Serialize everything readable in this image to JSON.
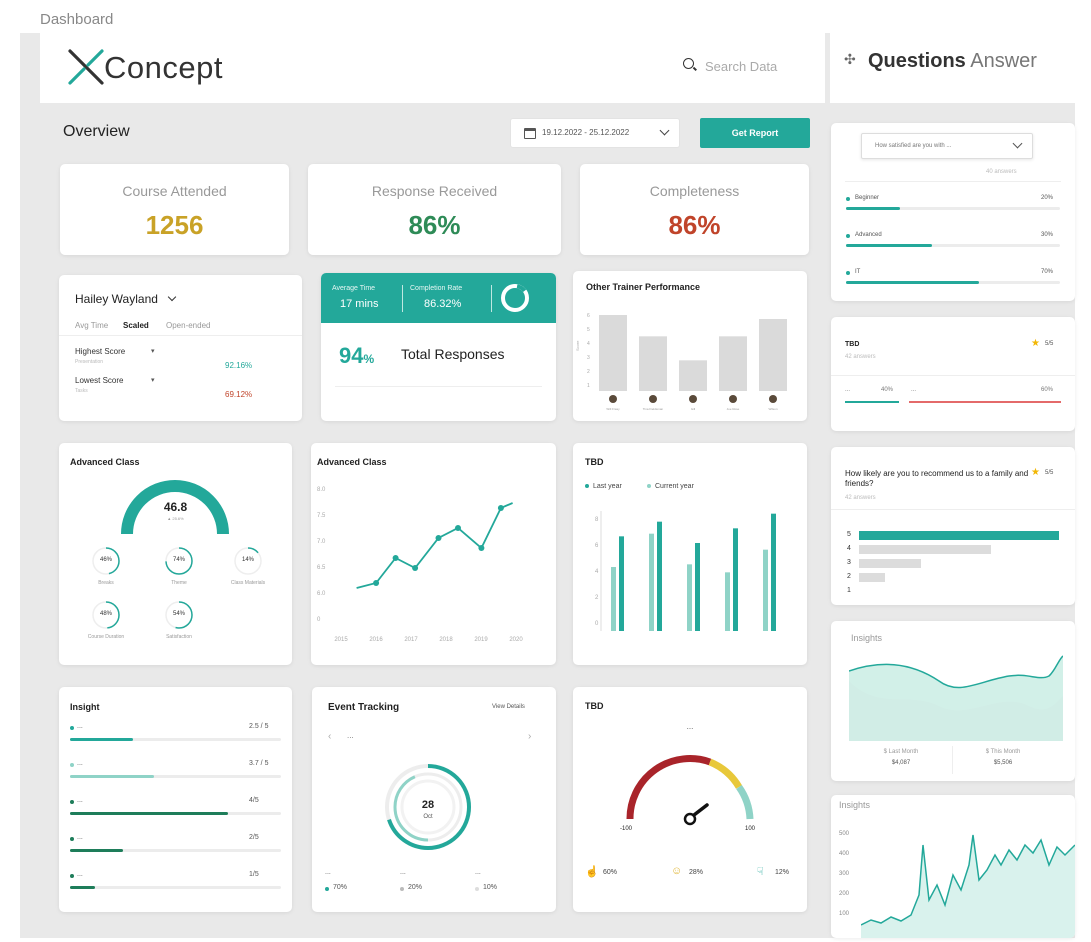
{
  "frame_label": "Dashboard",
  "header": {
    "logo_text": "Concept",
    "search_placeholder": "Search Data"
  },
  "overview": {
    "title": "Overview",
    "date_range": "19.12.2022 - 25.12.2022",
    "report_button": "Get Report"
  },
  "stats": [
    {
      "label": "Course Attended",
      "value": "1256",
      "color": "#c9a227"
    },
    {
      "label": "Response Received",
      "value": "86%",
      "color": "#2e8b57"
    },
    {
      "label": "Completeness",
      "value": "86%",
      "color": "#c0442a"
    }
  ],
  "trainer": {
    "name": "Hailey Wayland",
    "tabs": [
      "Avg Time",
      "Scaled",
      "Open-ended"
    ],
    "active_tab": "Scaled",
    "rows": [
      {
        "label": "Highest Score",
        "sub": "Presentation",
        "value": "92.16%",
        "color": "#23a89a"
      },
      {
        "label": "Lowest Score",
        "sub": "Tasks",
        "value": "69.12%",
        "color": "#c0442a"
      }
    ]
  },
  "responses": {
    "avg_time_label": "Average Time",
    "avg_time_value": "17 mins",
    "completion_label": "Completion Rate",
    "completion_value": "86.32%",
    "percent": "94",
    "percent_sign": "%",
    "total_label": "Total Responses"
  },
  "trainer_perf": {
    "title": "Other Trainer Performance",
    "ylabel": "Score",
    "yticks": [
      "6",
      "5",
      "4",
      "3",
      "2",
      "1"
    ],
    "names": [
      "Will Frasy",
      "Tina Fieldsman",
      "Gill",
      "Joe Rose",
      "Wilson"
    ],
    "chart_data": {
      "type": "bar",
      "categories": [
        "Will Frasy",
        "Tina Fieldsman",
        "Gill",
        "Joe Rose",
        "Wilson"
      ],
      "values": [
        5.7,
        4.1,
        2.3,
        4.1,
        5.4
      ],
      "ylim": [
        0,
        6
      ]
    }
  },
  "advanced_gauge": {
    "title": "Advanced Class",
    "value": "46.8",
    "delta": "▲ 25.6%",
    "rings": [
      {
        "pct": "46%",
        "label": "Breaks",
        "value": 46
      },
      {
        "pct": "74%",
        "label": "Theme",
        "value": 74
      },
      {
        "pct": "14%",
        "label": "Class Materials",
        "value": 14
      },
      {
        "pct": "48%",
        "label": "Course Duration",
        "value": 48
      },
      {
        "pct": "54%",
        "label": "Satisfaction",
        "value": 54
      }
    ]
  },
  "advanced_line": {
    "title": "Advanced Class",
    "chart_data": {
      "type": "line",
      "x": [
        "2015",
        "2016",
        "2017",
        "2018",
        "2019",
        "2020"
      ],
      "yticks": [
        "8.0",
        "7.5",
        "7.0",
        "6.5",
        "6.0",
        "0"
      ],
      "points": [
        [
          2015.4,
          6.0
        ],
        [
          2015.9,
          6.1
        ],
        [
          2016.4,
          6.6
        ],
        [
          2016.9,
          6.4
        ],
        [
          2017.5,
          7.0
        ],
        [
          2018.0,
          7.2
        ],
        [
          2018.6,
          6.8
        ],
        [
          2019.1,
          7.6
        ],
        [
          2019.4,
          7.7
        ]
      ],
      "ylim": [
        5.4,
        8.0
      ]
    }
  },
  "tbd_bars": {
    "title": "TBD",
    "legend": [
      "Last year",
      "Current year"
    ],
    "colors": [
      "#8fd3c7",
      "#23a89a"
    ],
    "yticks": [
      "8",
      "6",
      "4",
      "2",
      "0"
    ],
    "chart_data": {
      "type": "bar",
      "series": [
        {
          "name": "Last year",
          "values": [
            4.8,
            7.3,
            5.0,
            4.4,
            6.1
          ]
        },
        {
          "name": "Current year",
          "values": [
            7.1,
            8.2,
            6.6,
            7.7,
            8.8
          ]
        }
      ],
      "ylim": [
        0,
        9
      ]
    }
  },
  "insight": {
    "title": "Insight",
    "rows": [
      {
        "label": "...",
        "value": "2.5 / 5",
        "fill": 0.3,
        "color": "#23a89a"
      },
      {
        "label": "...",
        "value": "3.7 / 5",
        "fill": 0.4,
        "color": "#8fd3c7"
      },
      {
        "label": "...",
        "value": "4/5",
        "fill": 0.75,
        "color": "#1e7d5a"
      },
      {
        "label": "...",
        "value": "2/5",
        "fill": 0.25,
        "color": "#1e7d5a"
      },
      {
        "label": "...",
        "value": "1/5",
        "fill": 0.12,
        "color": "#1e7d5a"
      }
    ]
  },
  "event": {
    "title": "Event Tracking",
    "details": "View Details",
    "nav_text": "...",
    "day": "28",
    "month": "Oct",
    "legend": [
      {
        "label": "...",
        "pct": "70%",
        "color": "#23a89a"
      },
      {
        "label": "...",
        "pct": "20%",
        "color": "#bbbbbb"
      },
      {
        "label": "...",
        "pct": "10%",
        "color": "#dddddd"
      }
    ]
  },
  "tbd_gauge": {
    "title": "TBD",
    "top_text": "...",
    "min": "-100",
    "max": "100",
    "stats": [
      {
        "icon": "thumbs-up-icon",
        "pct": "60%",
        "color": "#c0442a"
      },
      {
        "icon": "neutral-icon",
        "pct": "28%",
        "color": "#e0b532"
      },
      {
        "icon": "thumbs-down-icon",
        "pct": "12%",
        "color": "#23a89a"
      }
    ]
  },
  "qa": {
    "title_bold": "Questions",
    "title_light": "Answer",
    "dropdown": "How satisfied are you with ...",
    "answers_count": "40 answers",
    "options": [
      {
        "label": "Beginner",
        "pct": "20%",
        "fill": 0.25
      },
      {
        "label": "Advanced",
        "pct": "30%",
        "fill": 0.4
      },
      {
        "label": "IT",
        "pct": "70%",
        "fill": 0.62
      }
    ]
  },
  "tbd_rating": {
    "title": "TBD",
    "answers": "42 answers",
    "score": "5/5",
    "left_pct": "40%",
    "right_pct": "60%",
    "left_label": "...",
    "right_label": "..."
  },
  "recommend": {
    "question": "How likely are you to recommend us to a family and friends?",
    "answers": "42 answers",
    "score": "5/5",
    "rows": [
      {
        "label": "5",
        "value": 1.0,
        "color": "#23a89a"
      },
      {
        "label": "4",
        "value": 0.66,
        "color": "#dcdcdc"
      },
      {
        "label": "3",
        "value": 0.31,
        "color": "#dcdcdc"
      },
      {
        "label": "2",
        "value": 0.13,
        "color": "#dcdcdc"
      },
      {
        "label": "1",
        "value": 0.0,
        "color": "#dcdcdc"
      }
    ]
  },
  "insights_area": {
    "title": "Insights",
    "left_label": "$ Last Month",
    "left_value": "$4,087",
    "right_label": "$ This Month",
    "right_value": "$5,506"
  },
  "insights_line": {
    "title": "Insights",
    "yticks": [
      "500",
      "400",
      "300",
      "200",
      "100"
    ]
  }
}
